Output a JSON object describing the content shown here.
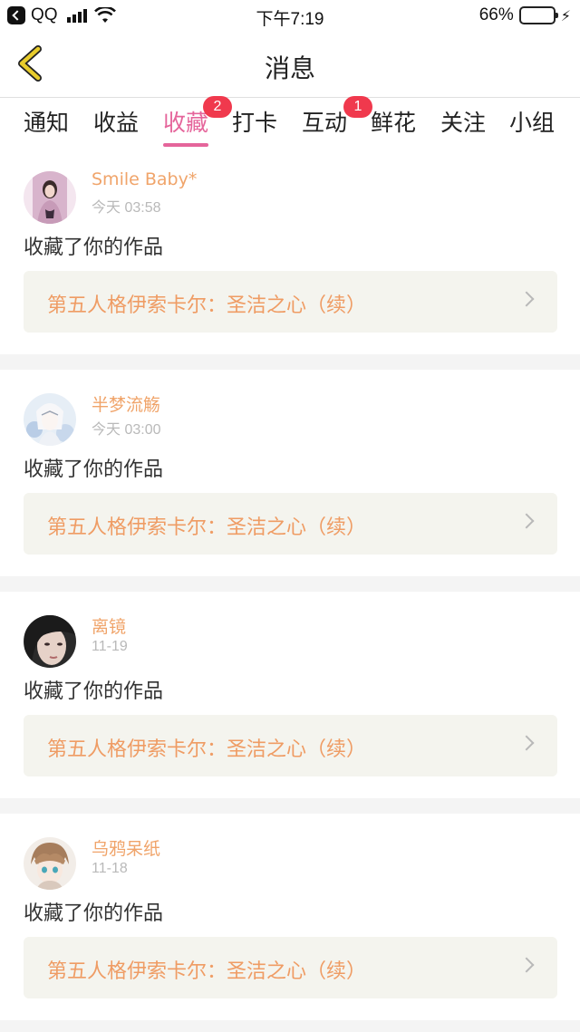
{
  "status_bar": {
    "app": "QQ",
    "time": "下午7:19",
    "battery": "66%",
    "battery_level": 0.66
  },
  "nav": {
    "title": "消息",
    "back_icon": "chevron-left-icon",
    "accent_color": "#e8cc2c"
  },
  "tabs": [
    {
      "label": "通知"
    },
    {
      "label": "收益"
    },
    {
      "label": "收藏",
      "active": true,
      "badge": "2"
    },
    {
      "label": "打卡"
    },
    {
      "label": "互动",
      "badge": "1"
    },
    {
      "label": "鲜花"
    },
    {
      "label": "关注"
    },
    {
      "label": "小组"
    }
  ],
  "colors": {
    "active_tab": "#e5659b",
    "badge": "#f0394d",
    "username": "#f0a46a",
    "work_title": "#ef9c64"
  },
  "messages": [
    {
      "user": "Smile Baby*",
      "time": "今天 03:58",
      "action": "收藏了你的作品",
      "work": "第五人格伊索卡尔：圣洁之心（续）"
    },
    {
      "user": "半梦流觞",
      "time": "今天 03:00",
      "action": "收藏了你的作品",
      "work": "第五人格伊索卡尔：圣洁之心（续）"
    },
    {
      "user": "离镜",
      "time": "11-19",
      "action": "收藏了你的作品",
      "work": "第五人格伊索卡尔：圣洁之心（续）"
    },
    {
      "user": "乌鸦呆纸",
      "time": "11-18",
      "action": "收藏了你的作品",
      "work": "第五人格伊索卡尔：圣洁之心（续）"
    }
  ]
}
